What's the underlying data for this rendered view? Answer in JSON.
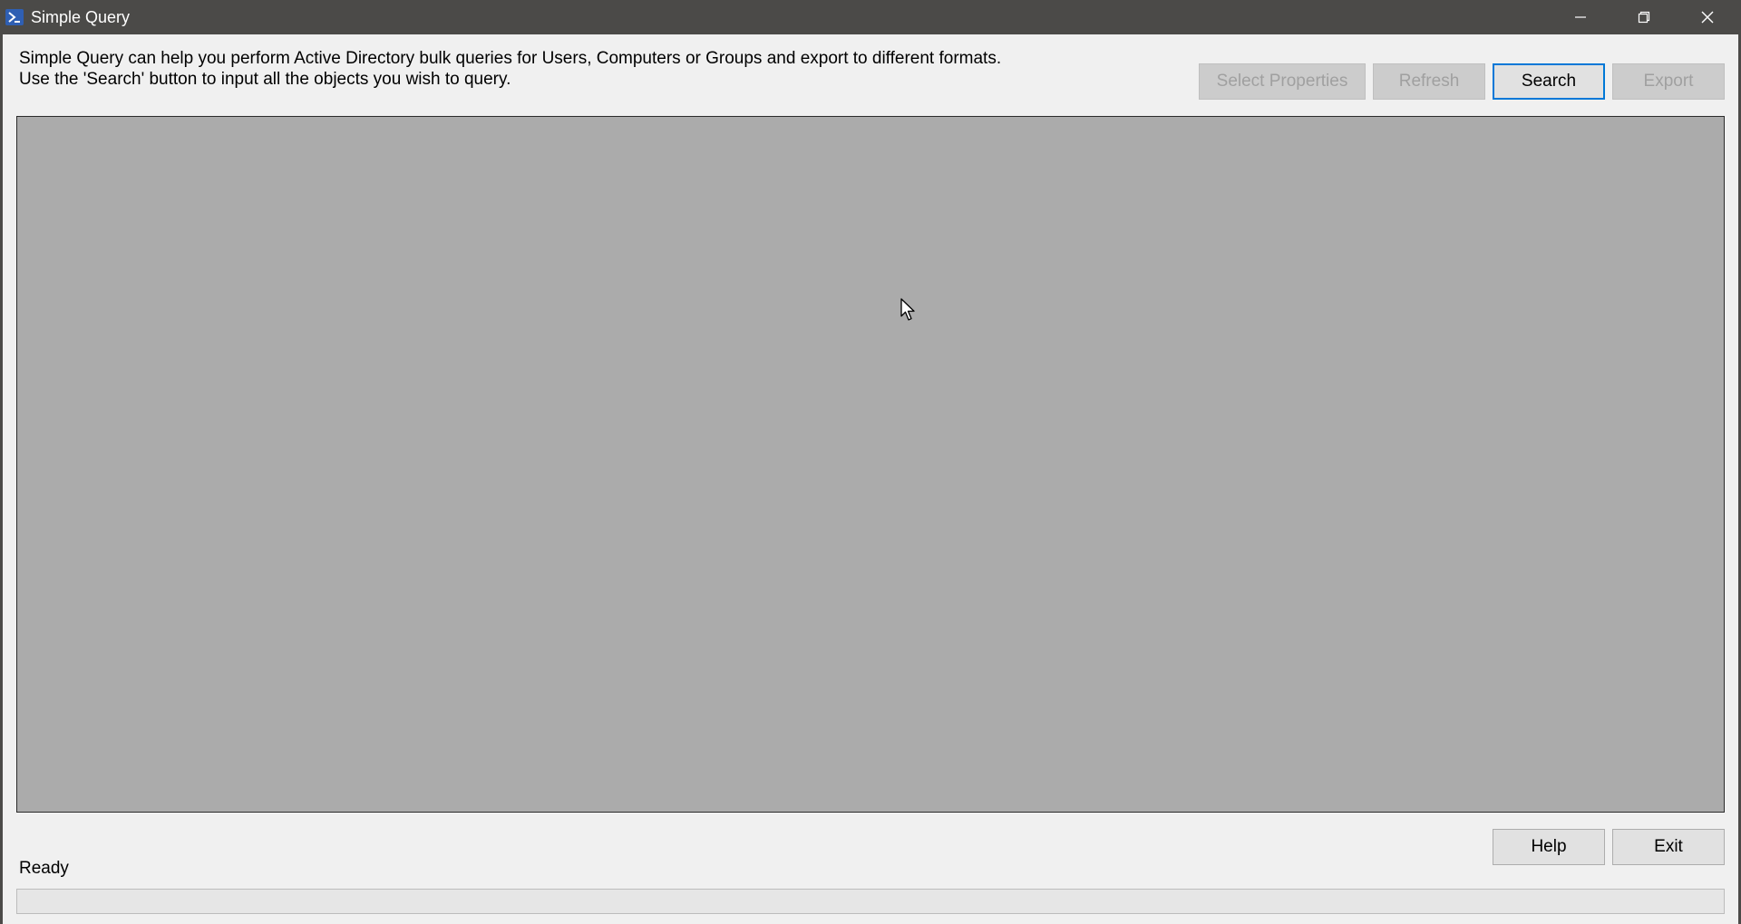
{
  "window": {
    "title": "Simple Query",
    "icon": "powershell-icon",
    "controls": [
      "minimize-icon",
      "restore-icon",
      "close-icon"
    ]
  },
  "description": {
    "line1": "Simple Query can help you perform Active Directory bulk queries for Users, Computers or Groups and export to different formats.",
    "line2": "Use the 'Search' button to input all the objects you wish to query."
  },
  "toolbar": {
    "select_properties_label": "Select Properties",
    "refresh_label": "Refresh",
    "search_label": "Search",
    "export_label": "Export"
  },
  "footer": {
    "help_label": "Help",
    "exit_label": "Exit",
    "status": "Ready",
    "progress": 0
  },
  "colors": {
    "titlebar": "#4b4a48",
    "grid_background": "#ababab",
    "focus_accent": "#0078d7"
  }
}
